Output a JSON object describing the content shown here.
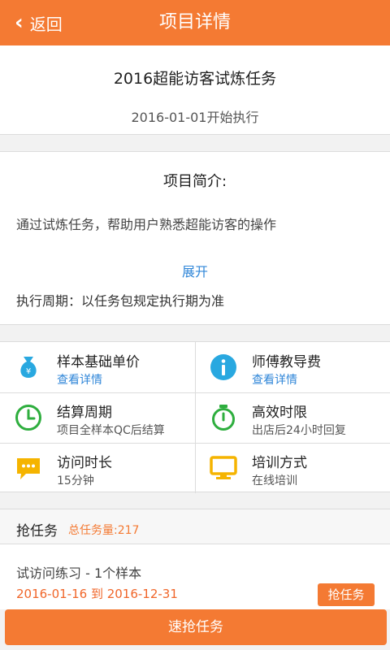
{
  "header": {
    "back_label": "返回",
    "title": "项目详情"
  },
  "project": {
    "name": "2016超能访客试炼任务",
    "start": "2016-01-01开始执行"
  },
  "intro": {
    "heading": "项目简介:",
    "description": "通过试炼任务，帮助用户熟悉超能访客的操作",
    "expand_label": "展开",
    "period": "执行周期：以任务包规定执行期为准"
  },
  "info": [
    {
      "title": "样本基础单价",
      "sub": "查看详情",
      "icon": "money-bag-icon",
      "color": "#29a8e0"
    },
    {
      "title": "师傅教导费",
      "sub": "查看详情",
      "icon": "info-circle-icon",
      "color": "#29a8e0"
    },
    {
      "title": "结算周期",
      "sub": "项目全样本QC后结算",
      "icon": "clock-icon",
      "color": "#2eae3e"
    },
    {
      "title": "高效时限",
      "sub": "出店后24小时回复",
      "icon": "stopwatch-icon",
      "color": "#2eae3e"
    },
    {
      "title": "访问时长",
      "sub": "15分钟",
      "icon": "chat-bubble-icon",
      "color": "#f5b400"
    },
    {
      "title": "培训方式",
      "sub": "在线培训",
      "icon": "monitor-icon",
      "color": "#f5b400"
    }
  ],
  "grab": {
    "label": "抢任务",
    "count": "总任务量:217"
  },
  "task": {
    "name": "试访问练习 - 1个样本",
    "dates": "2016-01-16 到 2016-12-31",
    "button": "抢任务"
  },
  "bottom": {
    "button": "速抢任务"
  },
  "colors": {
    "accent": "#f47a33",
    "link": "#2f86d8"
  }
}
